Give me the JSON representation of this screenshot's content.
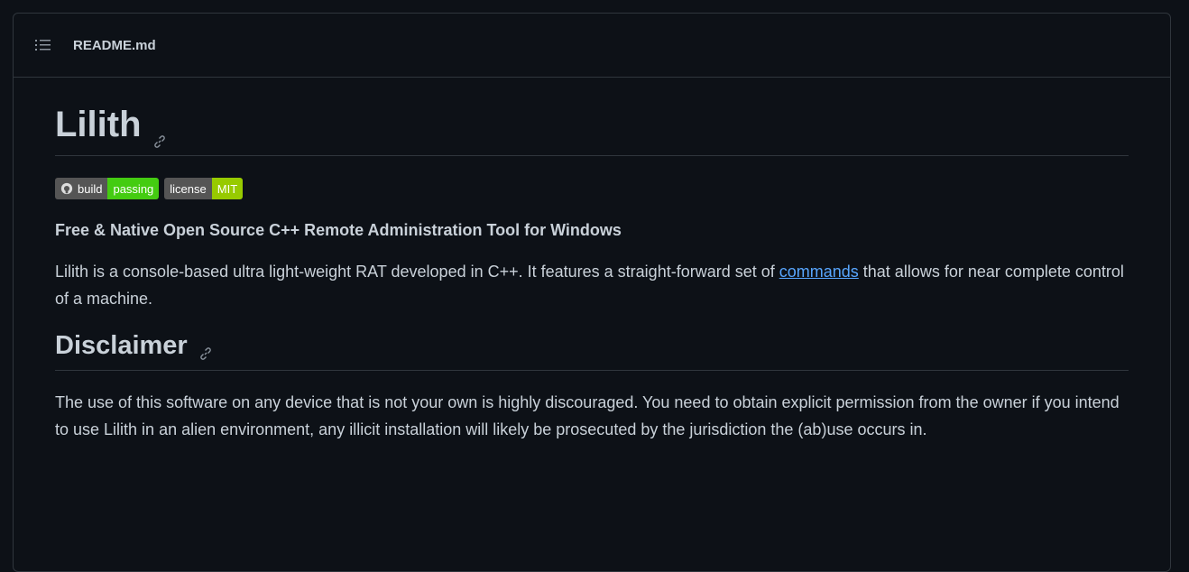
{
  "header": {
    "filename": "README.md"
  },
  "readme": {
    "title": "Lilith",
    "badges": [
      {
        "left": "build",
        "right": "passing",
        "right_color": "#44cc11"
      },
      {
        "left": "license",
        "right": "MIT",
        "right_color": "#97ca00"
      }
    ],
    "tagline": "Free & Native Open Source C++ Remote Administration Tool for Windows",
    "intro_before_link": "Lilith is a console-based ultra light-weight RAT developed in C++. It features a straight-forward set of ",
    "intro_link": "commands",
    "intro_after_link": " that allows for near complete control of a machine.",
    "disclaimer_heading": "Disclaimer",
    "disclaimer_text": "The use of this software on any device that is not your own is highly discouraged. You need to obtain explicit permission from the owner if you intend to use Lilith in an alien environment, any illicit installation will likely be prosecuted by the jurisdiction the (ab)use occurs in."
  },
  "colors": {
    "background": "#0d1117",
    "border": "#30363d",
    "text": "#c9d1d9",
    "link": "#58a6ff"
  }
}
